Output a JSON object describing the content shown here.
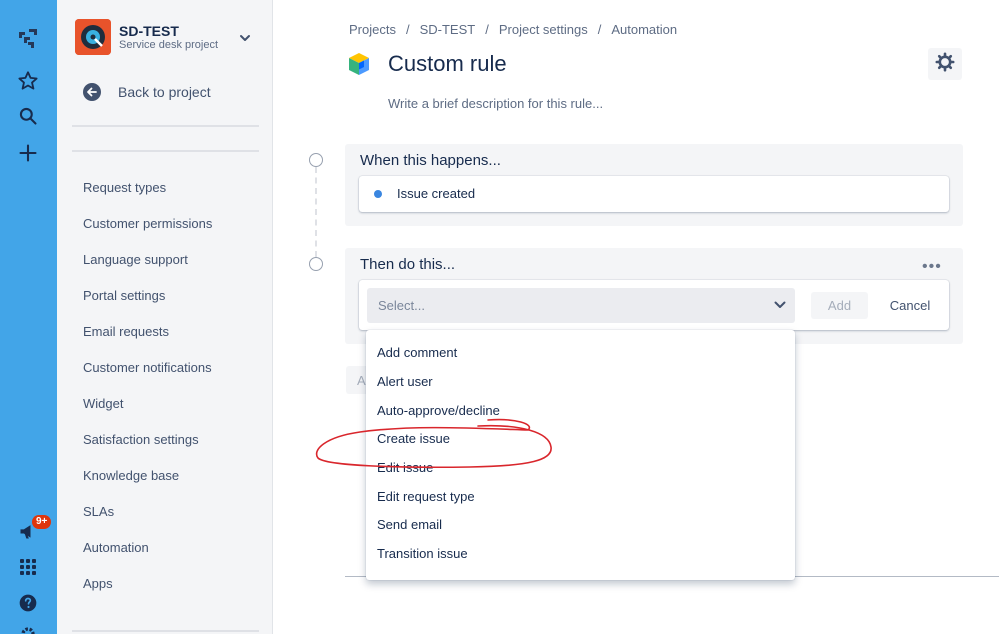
{
  "global_nav": {
    "notification_badge": "9+",
    "icons": [
      "jira-logo-icon",
      "star-icon",
      "search-icon",
      "plus-icon",
      "megaphone-icon",
      "app-grid-icon",
      "help-icon",
      "settings-icon"
    ]
  },
  "sidebar": {
    "project_name": "SD-TEST",
    "project_type": "Service desk project",
    "back_label": "Back to project",
    "items": [
      {
        "label": "Request types"
      },
      {
        "label": "Customer permissions"
      },
      {
        "label": "Language support"
      },
      {
        "label": "Portal settings"
      },
      {
        "label": "Email requests"
      },
      {
        "label": "Customer notifications"
      },
      {
        "label": "Widget"
      },
      {
        "label": "Satisfaction settings"
      },
      {
        "label": "Knowledge base"
      },
      {
        "label": "SLAs"
      },
      {
        "label": "Automation"
      },
      {
        "label": "Apps"
      }
    ]
  },
  "breadcrumbs": [
    "Projects",
    "SD-TEST",
    "Project settings",
    "Automation"
  ],
  "rule": {
    "title": "Custom rule",
    "description_placeholder": "Write a brief description for this rule..."
  },
  "when_panel": {
    "title": "When this happens...",
    "trigger": "Issue created"
  },
  "then_panel": {
    "title": "Then do this...",
    "more": "•••",
    "select_placeholder": "Select...",
    "add_label": "Add",
    "cancel_label": "Cancel",
    "hidden_button_initial": "A"
  },
  "dropdown": {
    "options": [
      "Add comment",
      "Alert user",
      "Auto-approve/decline",
      "Create issue",
      "Edit issue",
      "Edit request type",
      "Send email",
      "Transition issue"
    ]
  },
  "colors": {
    "nav_rail": "#42a5e8",
    "annotation": "#d9262c",
    "trigger_dot": "#3a86e0"
  }
}
